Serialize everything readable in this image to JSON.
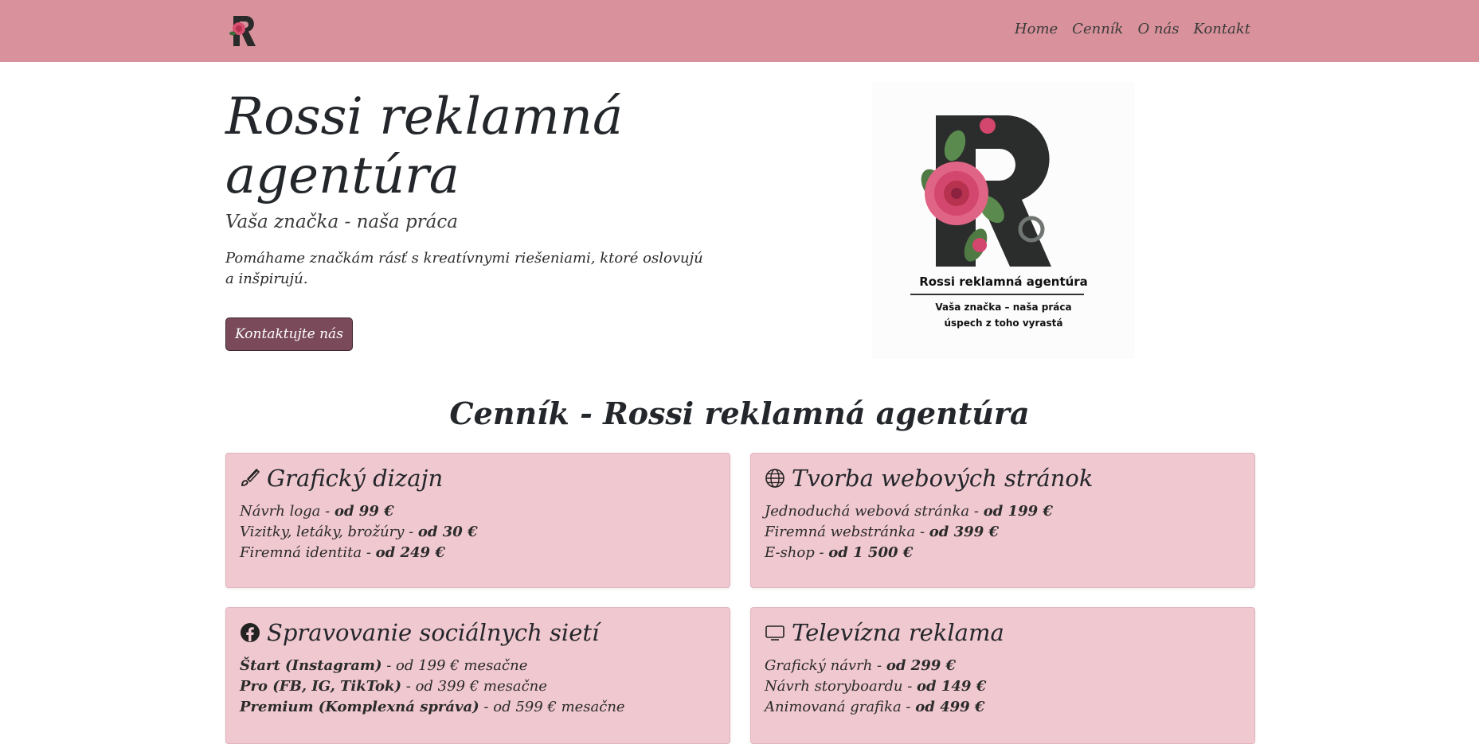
{
  "nav": {
    "links": [
      "Home",
      "Cenník",
      "O nás",
      "Kontakt"
    ]
  },
  "hero": {
    "title": "Rossi reklamná agentúra",
    "subtitle": "Vaša značka - naša práca",
    "description": "Pomáhame značkám rásť s kreatívnymi riešeniami, ktoré oslovujú a inšpirujú.",
    "button": "Kontaktujte nás",
    "logo_lines": [
      "Rossi reklamná agentúra",
      "Vaša značka – naša práca",
      "úspech z toho vyrastá"
    ]
  },
  "pricing": {
    "title": "Cenník - Rossi reklamná agentúra",
    "cards": [
      {
        "title": "Grafický dizajn",
        "icon": "brush-icon",
        "items": [
          {
            "name": "Návrh loga",
            "price": "od 99 €",
            "suffix": ""
          },
          {
            "name": "Vizitky, letáky, brožúry",
            "price": "od 30 €",
            "suffix": ""
          },
          {
            "name": "Firemná identita",
            "price": "od 249 €",
            "suffix": ""
          }
        ]
      },
      {
        "title": "Tvorba webových stránok",
        "icon": "globe-icon",
        "items": [
          {
            "name": "Jednoduchá webová stránka",
            "price": "od 199 €",
            "suffix": ""
          },
          {
            "name": "Firemná webstránka",
            "price": "od 399 €",
            "suffix": ""
          },
          {
            "name": "E-shop",
            "price": "od 1 500 €",
            "suffix": ""
          }
        ]
      },
      {
        "title": "Spravovanie sociálnych sietí",
        "icon": "facebook-icon",
        "items": [
          {
            "name": "Štart (Instagram)",
            "price": "od 199 € mesačne",
            "suffix": ""
          },
          {
            "name": "Pro (FB, IG, TikTok)",
            "price": "od 399 € mesačne",
            "suffix": ""
          },
          {
            "name": "Premium (Komplexná správa)",
            "price": "od 599 € mesačne",
            "suffix": ""
          }
        ]
      },
      {
        "title": "Televízna reklama",
        "icon": "tv-icon",
        "items": [
          {
            "name": "Grafický návrh",
            "price": "od 299 €",
            "suffix": ""
          },
          {
            "name": "Návrh storyboardu",
            "price": "od 149 €",
            "suffix": ""
          },
          {
            "name": "Animovaná grafika",
            "price": "od 499 €",
            "suffix": ""
          }
        ]
      }
    ]
  },
  "colors": {
    "navbar": "#d9929c",
    "card": "#f0c8d0",
    "button": "#7a4a5a"
  }
}
